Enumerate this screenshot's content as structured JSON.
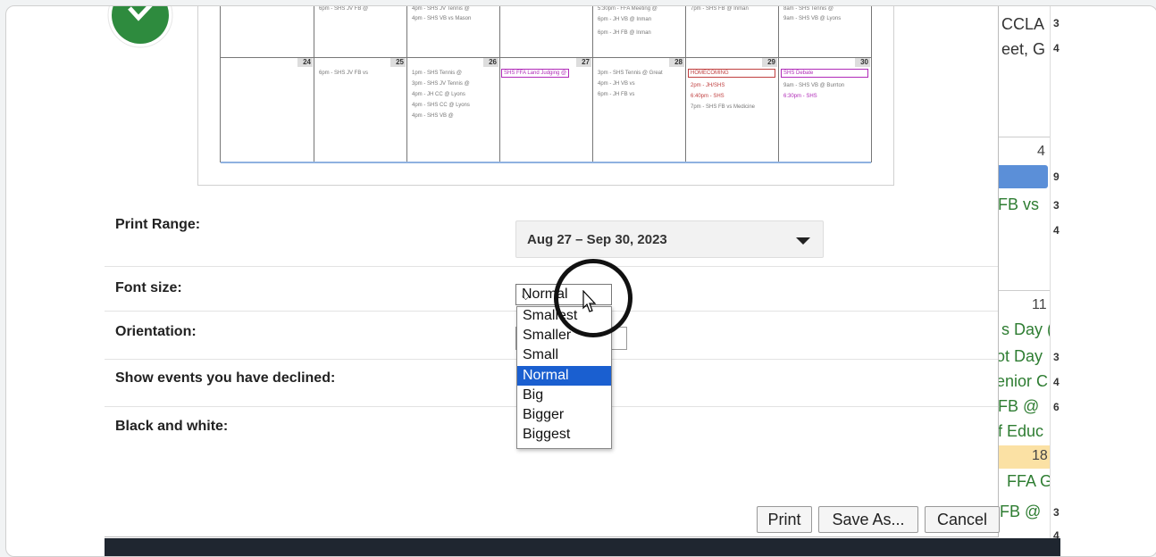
{
  "preview": {
    "day_numbers": [
      "24",
      "25",
      "26",
      "27",
      "28",
      "29",
      "30"
    ],
    "top_events": {
      "c1": [
        "6pm - SHS JV FB @"
      ],
      "c2": [
        "4pm - SHS JV Tennis @",
        "4pm - SHS VB vs Mason"
      ],
      "c4": [
        "5:30pm - FFA Meeting @",
        "6pm - JH VB @ Inman",
        "6pm - JH FB @ Inman"
      ],
      "c5": [
        "7pm - SHS FB @ Inman"
      ],
      "c6": [
        "8am - SHS Tennis @",
        "9am - SHS VB @ Lyons"
      ]
    },
    "week_events": {
      "c1": [
        "6pm - SHS JV FB vs"
      ],
      "c2": [
        "1pm - SHS Tennis @",
        "3pm - SHS JV Tennis @",
        "4pm - JH CC @ Lyons",
        "4pm - SHS CC @ Lyons",
        "4pm - SHS VB @"
      ],
      "c3_tag": "SHS FFA Land Judging @",
      "c4": [
        "3pm - SHS Tennis @ Great",
        "4pm - JH VB vs",
        "6pm - JH FB vs"
      ],
      "c5_tag": "HOMECOMING",
      "c5": [
        "2pm - JH/SHS",
        "6:40pm - SHS",
        "7pm - SHS FB vs Medicine"
      ],
      "c6_tag": "SHS Debate",
      "c6": [
        "9am - SHS VB @ Burrton",
        "6:30pm - SHS"
      ]
    }
  },
  "background_calendar": {
    "texts": [
      "CCLA",
      "eet, G",
      "FB vs",
      "s Day (",
      "ot Day",
      "enior C",
      "FB @",
      "f Educ",
      "FFA G",
      "FB @"
    ],
    "day_numbers": [
      "4",
      "11",
      "18"
    ],
    "side_numbers": [
      "3",
      "4",
      "9",
      "3",
      "4",
      "3",
      "4",
      "6",
      "3",
      "4"
    ]
  },
  "form": {
    "print_range_label": "Print Range:",
    "print_range_value": "Aug 27 – Sep 30, 2023",
    "font_size_label": "Font size:",
    "font_size_value": "Normal",
    "orientation_label": "Orientation:",
    "declined_label": "Show events you have declined:",
    "bw_label": "Black and white:"
  },
  "font_size_options": [
    "Smallest",
    "Smaller",
    "Small",
    "Normal",
    "Big",
    "Bigger",
    "Biggest"
  ],
  "buttons": {
    "print": "Print",
    "save_as": "Save As...",
    "cancel": "Cancel"
  },
  "colors": {
    "accent": "#1a5fd0",
    "logo_green": "#2e8b3e",
    "event_purple": "#b02ab8"
  },
  "icons": [
    "check-logo-icon",
    "dropdown-triangle-icon",
    "chevron-down-icon",
    "mouse-cursor-icon"
  ]
}
